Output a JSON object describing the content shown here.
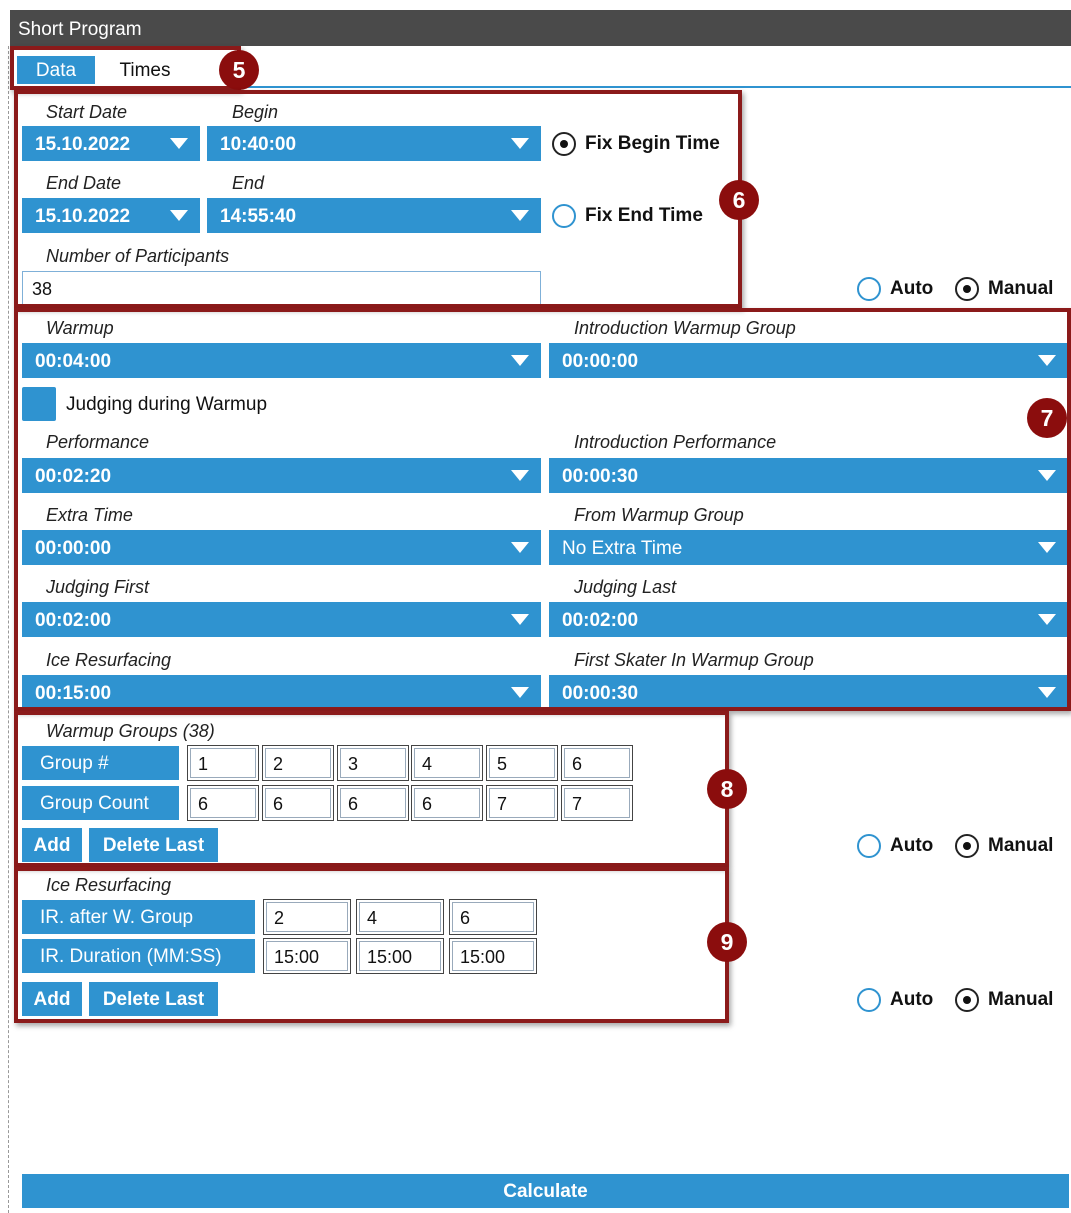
{
  "window": {
    "title": "Short Program"
  },
  "tabs": [
    {
      "label": "Data"
    },
    {
      "label": "Times"
    }
  ],
  "badges": [
    "5",
    "6",
    "7",
    "8",
    "9"
  ],
  "schedule": {
    "start_date_label": "Start Date",
    "start_date_value": "15.10.2022",
    "begin_label": "Begin",
    "begin_value": "10:40:00",
    "fix_begin_label": "Fix Begin Time",
    "end_date_label": "End Date",
    "end_date_value": "15.10.2022",
    "end_label": "End",
    "end_value": "14:55:40",
    "fix_end_label": "Fix End Time",
    "participants_label": "Number of Participants",
    "participants_value": "38",
    "mode_auto": "Auto",
    "mode_manual": "Manual"
  },
  "times": {
    "warmup_label": "Warmup",
    "warmup_value": "00:04:00",
    "intro_warmup_label": "Introduction Warmup Group",
    "intro_warmup_value": "00:00:00",
    "judging_warmup_label": "Judging during Warmup",
    "performance_label": "Performance",
    "performance_value": "00:02:20",
    "intro_performance_label": "Introduction Performance",
    "intro_performance_value": "00:00:30",
    "extra_time_label": "Extra Time",
    "extra_time_value": "00:00:00",
    "from_warmup_label": "From Warmup Group",
    "from_warmup_value": "No Extra Time",
    "judging_first_label": "Judging First",
    "judging_first_value": "00:02:00",
    "judging_last_label": "Judging Last",
    "judging_last_value": "00:02:00",
    "ice_resurfacing_label": "Ice Resurfacing",
    "ice_resurfacing_value": "00:15:00",
    "first_skater_label": "First Skater In Warmup Group",
    "first_skater_value": "00:00:30"
  },
  "warmup_groups": {
    "title": "Warmup Groups (38)",
    "group_num_label": "Group #",
    "group_count_label": "Group Count",
    "group_nums": [
      "1",
      "2",
      "3",
      "4",
      "5",
      "6"
    ],
    "group_counts": [
      "6",
      "6",
      "6",
      "6",
      "7",
      "7"
    ],
    "add_label": "Add",
    "delete_label": "Delete Last",
    "mode_auto": "Auto",
    "mode_manual": "Manual"
  },
  "ice_resurfacing": {
    "title": "Ice Resurfacing",
    "after_group_label": "IR. after W. Group",
    "duration_label": "IR. Duration (MM:SS)",
    "after_groups": [
      "2",
      "4",
      "6"
    ],
    "durations": [
      "15:00",
      "15:00",
      "15:00"
    ],
    "add_label": "Add",
    "delete_label": "Delete Last",
    "mode_auto": "Auto",
    "mode_manual": "Manual"
  },
  "footer": {
    "calculate_label": "Calculate"
  },
  "colors": {
    "accent": "#2f93d0",
    "title_bar": "#4a4a4a",
    "annotation": "#8b1a1a"
  }
}
